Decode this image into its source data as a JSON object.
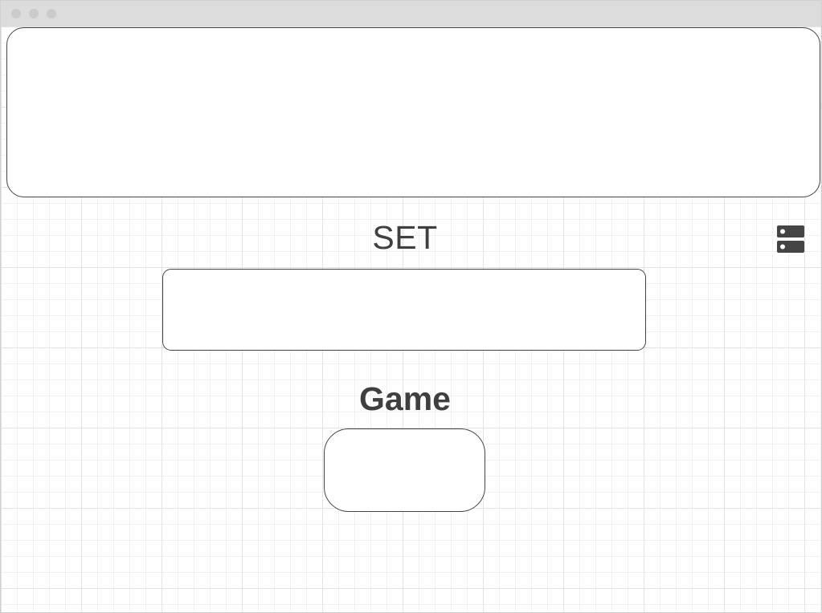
{
  "window": {
    "traffic_lights": [
      "close",
      "minimize",
      "maximize"
    ]
  },
  "main": {
    "set_label": "SET",
    "game_label": "Game",
    "menu_icon": "server-stack-icon"
  },
  "colors": {
    "titlebar": "#dcdcdc",
    "text": "#3f3f3f",
    "border": "#444444",
    "grid_major": "#e3e3e3",
    "grid_minor": "#f1f1f1"
  }
}
